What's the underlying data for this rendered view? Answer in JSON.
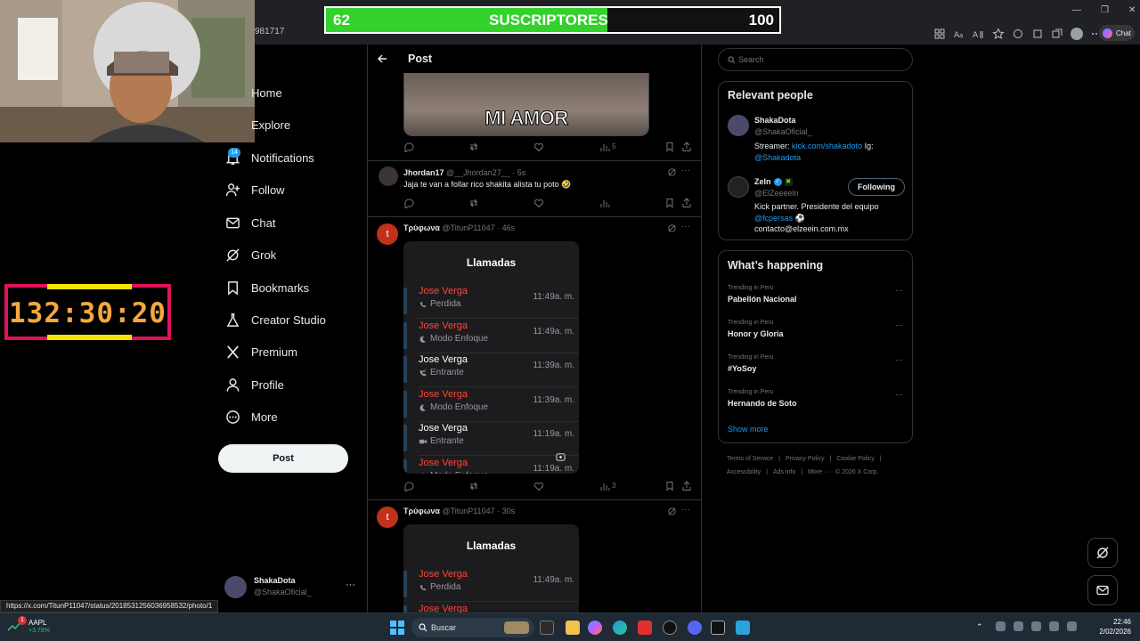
{
  "browser": {
    "url_fragment": "981717",
    "chat_label": "Chat"
  },
  "overlay": {
    "subscribers": {
      "current": "62",
      "label": "SUSCRIPTORES",
      "goal": "100",
      "progress": 0.62
    },
    "timer": "132:30:20"
  },
  "nav": {
    "items": [
      {
        "label": "Home",
        "icon": "home-icon"
      },
      {
        "label": "Explore",
        "icon": "search-icon"
      },
      {
        "label": "Notifications",
        "icon": "bell-icon",
        "badge": "14"
      },
      {
        "label": "Follow",
        "icon": "person-plus-icon"
      },
      {
        "label": "Chat",
        "icon": "mail-icon"
      },
      {
        "label": "Grok",
        "icon": "grok-icon"
      },
      {
        "label": "Bookmarks",
        "icon": "bookmark-icon"
      },
      {
        "label": "Creator Studio",
        "icon": "flask-icon"
      },
      {
        "label": "Premium",
        "icon": "x-logo-icon"
      },
      {
        "label": "Profile",
        "icon": "person-icon"
      },
      {
        "label": "More",
        "icon": "more-circle-icon"
      }
    ],
    "post_button": "Post",
    "account": {
      "name": "ShakaDota",
      "handle": "@ShakaOficial_"
    }
  },
  "main": {
    "header_title": "Post",
    "meme_caption": "MI AMOR",
    "tweet0": {
      "views": "5"
    },
    "tweet1": {
      "name": "Jhordan17",
      "handle": "@__Jhordan27__",
      "time": "· 5s",
      "text": "Jaja te van a follar rico shakita alista tu poto 🤣"
    },
    "tweet2": {
      "avatar_letter": "t",
      "name": "Τρύφωνα",
      "handle": "@TitunP11047",
      "time": "· 46s",
      "views": "3",
      "card_title": "Llamadas",
      "calls": [
        {
          "name": "Jose Verga",
          "status": "Perdida",
          "time": "11:49a. m.",
          "missed": true,
          "icon": "phone-missed-icon"
        },
        {
          "name": "Jose Verga",
          "status": "Modo Enfoque",
          "time": "11:49a. m.",
          "missed": true,
          "icon": "moon-icon"
        },
        {
          "name": "Jose Verga",
          "status": "Entrante",
          "time": "11:39a. m.",
          "missed": false,
          "icon": "phone-incoming-icon"
        },
        {
          "name": "Jose Verga",
          "status": "Modo Enfoque",
          "time": "11:39a. m.",
          "missed": true,
          "icon": "moon-icon"
        },
        {
          "name": "Jose Verga",
          "status": "Entrante",
          "time": "11:19a. m.",
          "missed": false,
          "icon": "video-icon"
        },
        {
          "name": "Jose Verga",
          "status": "Modo Enfoque",
          "time": "11:19a. m.",
          "missed": true,
          "icon": "moon-icon"
        }
      ]
    },
    "tweet3": {
      "avatar_letter": "t",
      "name": "Τρύφωνα",
      "handle": "@TitunP11047",
      "time": "· 30s",
      "card_title": "Llamadas",
      "calls": [
        {
          "name": "Jose Verga",
          "status": "Perdida",
          "time": "11:49a. m.",
          "missed": true
        },
        {
          "name": "Jose Verga",
          "status": "",
          "time": "",
          "missed": true
        }
      ]
    }
  },
  "sidebar": {
    "search_placeholder": "Search",
    "relevant_title": "Relevant people",
    "people": [
      {
        "name": "ShakaDota",
        "handle": "@ShakaOficial_",
        "bio_prefix": "Streamer: ",
        "bio_link": "kick.com/shakadoto",
        "bio_mid": " Ig:",
        "bio_link2": "@Shakadota"
      },
      {
        "name": "Zeln",
        "handle": "@ElZeeeeln",
        "follow_label": "Following",
        "bio_line1": "Kick partner. Presidente del equipo",
        "bio_link": "@fcpersas",
        "bio_emoji": " ⚽",
        "bio_line3": "contacto@elzeein.com.mx"
      }
    ],
    "happening_title": "What’s happening",
    "trends": [
      {
        "category": "Trending in Peru",
        "name": "Pabellón Nacional"
      },
      {
        "category": "Trending in Peru",
        "name": "Honor y Gloria"
      },
      {
        "category": "Trending in Peru",
        "name": "#YoSoy"
      },
      {
        "category": "Trending in Peru",
        "name": "Hernando de Soto"
      }
    ],
    "show_more": "Show more",
    "footer_line1": [
      "Terms of Service",
      "|",
      "Privacy Policy",
      "|",
      "Cookie Policy",
      "|"
    ],
    "footer_line2": [
      "Accessibility",
      "|",
      "Ads info",
      "|",
      "More ···",
      "© 2026 X Corp."
    ]
  },
  "status_url": "https://x.com/TitunP11047/status/2018531256036958532/photo/1",
  "taskbar": {
    "stock": {
      "symbol": "AAPL",
      "change": "+3.78%",
      "badge": "1"
    },
    "search_label": "Buscar",
    "time": "22:46",
    "date": "2/02/2026"
  },
  "colors": {
    "accent": "#1d9bf0",
    "missed": "#ff453a",
    "sub_green": "#33d12c",
    "timer_border": "#e0125a",
    "timer_text": "#f7a73c"
  }
}
